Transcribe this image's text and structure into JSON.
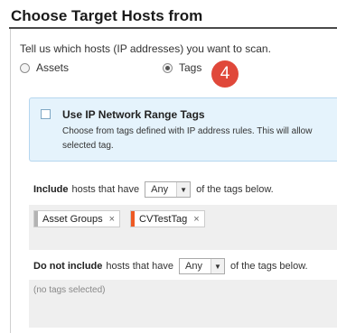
{
  "header": {
    "title": "Choose Target Hosts from"
  },
  "prompt": "Tell us which hosts (IP addresses) you want to scan.",
  "target_options": [
    {
      "label": "Assets",
      "selected": false
    },
    {
      "label": "Tags",
      "selected": true
    }
  ],
  "step_badge": "4",
  "ip_range_tags": {
    "title": "Use IP Network Range Tags",
    "description": "Choose from tags defined with IP address rules. This will allow\nselected tag.",
    "checked": false
  },
  "include": {
    "label_bold": "Include",
    "label_rest": "hosts that have",
    "match": "Any",
    "suffix": "of the tags below.",
    "tags": [
      {
        "label": "Asset Groups",
        "color": "#b3b3b3"
      },
      {
        "label": "CVTestTag",
        "color": "#ee5a24"
      }
    ]
  },
  "exclude": {
    "label_bold": "Do not include",
    "label_rest": "hosts that have",
    "match": "Any",
    "suffix": "of the tags below.",
    "empty_text": "(no tags selected)"
  },
  "icons": {
    "remove": "×",
    "dropdown": "▼"
  }
}
